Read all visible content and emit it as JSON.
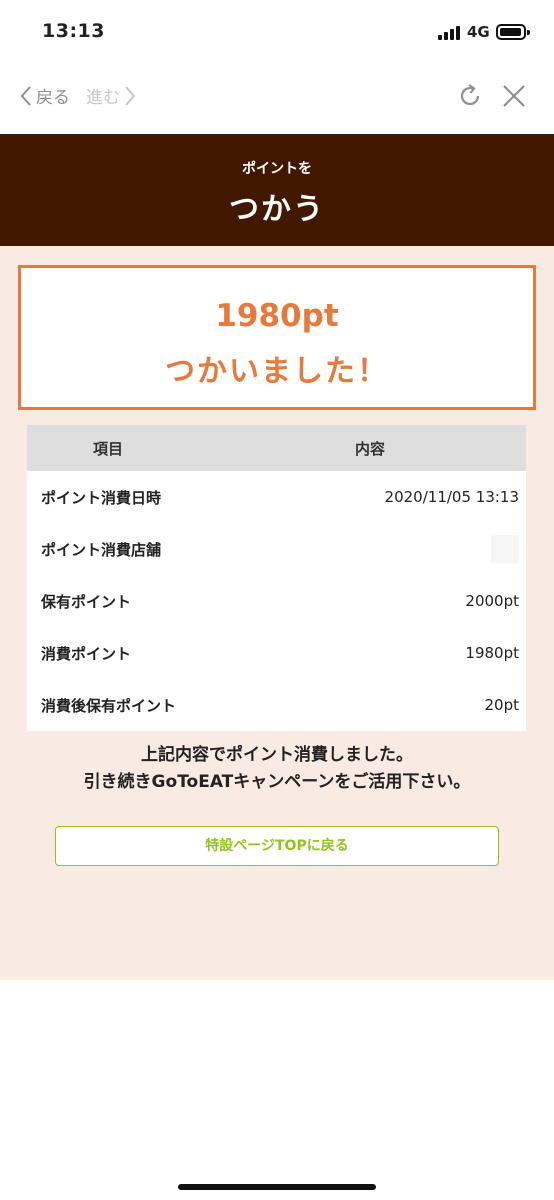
{
  "status_bar": {
    "time": "13:13",
    "network": "4G"
  },
  "browser_nav": {
    "back_label": "戻る",
    "forward_label": "進む"
  },
  "header": {
    "subtitle": "ポイントを",
    "title": "つかう"
  },
  "result": {
    "points": "1980pt",
    "message": "つかいました！"
  },
  "table": {
    "headers": [
      "項目",
      "内容"
    ],
    "rows": [
      {
        "label": "ポイント消費日時",
        "value": "2020/11/05 13:13"
      },
      {
        "label": "ポイント消費店舗",
        "value": ""
      },
      {
        "label": "保有ポイント",
        "value": "2000pt"
      },
      {
        "label": "消費ポイント",
        "value": "1980pt"
      },
      {
        "label": "消費後保有ポイント",
        "value": "20pt"
      }
    ]
  },
  "notice": {
    "line1": "上記内容でポイント消費しました。",
    "line2": "引き続きGoToEATキャンペーンをご活用下さい。"
  },
  "button": {
    "label": "特設ページTOPに戻る"
  },
  "colors": {
    "header_bg": "#421800",
    "accent_orange": "#e8793c",
    "content_bg": "#faeae4",
    "button_green": "#8fc31f"
  }
}
